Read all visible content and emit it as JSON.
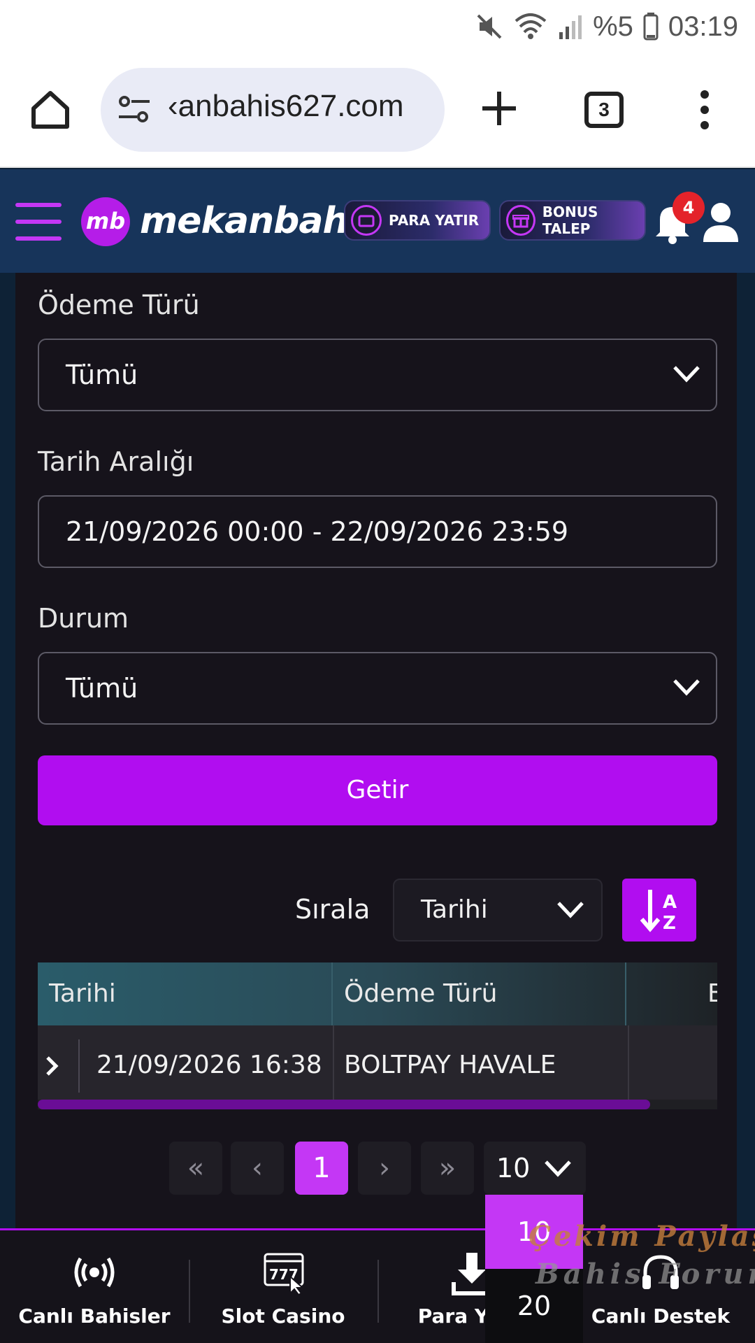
{
  "status_bar": {
    "battery_text": "%5",
    "time": "03:19"
  },
  "browser": {
    "url": "‹anbahis627.com",
    "tab_count": "3"
  },
  "header": {
    "logo_mark": "mb",
    "logo_text": "mekanbahis",
    "deposit_label": "PARA YATIR",
    "bonus_label": "BONUS TALEP",
    "notification_count": "4"
  },
  "filters": {
    "payment_type_label": "Ödeme Türü",
    "payment_type_value": "Tümü",
    "date_range_label": "Tarih Aralığı",
    "date_range_value": "21/09/2026 00:00 - 22/09/2026 23:59",
    "status_label": "Durum",
    "status_value": "Tümü",
    "submit_label": "Getir"
  },
  "sort": {
    "label": "Sırala",
    "value": "Tarihi"
  },
  "table": {
    "headers": [
      "Tarihi",
      "Ödeme Türü",
      "B"
    ],
    "rows": [
      {
        "date": "21/09/2026 16:38",
        "payment_type": "BOLTPAY HAVALE"
      }
    ]
  },
  "pagination": {
    "first": "«",
    "prev": "‹",
    "current": "1",
    "next": "›",
    "last": "»",
    "page_size": "10",
    "page_size_options": [
      "10",
      "20"
    ]
  },
  "bottom_nav": {
    "items": [
      {
        "label": "Canlı Bahisler",
        "icon": "live-broadcast-icon"
      },
      {
        "label": "Slot Casino",
        "icon": "slot-machine-icon"
      },
      {
        "label": "Para Yatır",
        "icon": "download-icon"
      },
      {
        "label": "Canlı Destek",
        "icon": "headset-icon"
      }
    ]
  },
  "watermark": {
    "line1": "Çekim Paylaş",
    "line2": "Bahis Forum"
  },
  "colors": {
    "accent": "#b10df0",
    "header_bg": "#17345a",
    "panel_bg": "#16131b"
  }
}
